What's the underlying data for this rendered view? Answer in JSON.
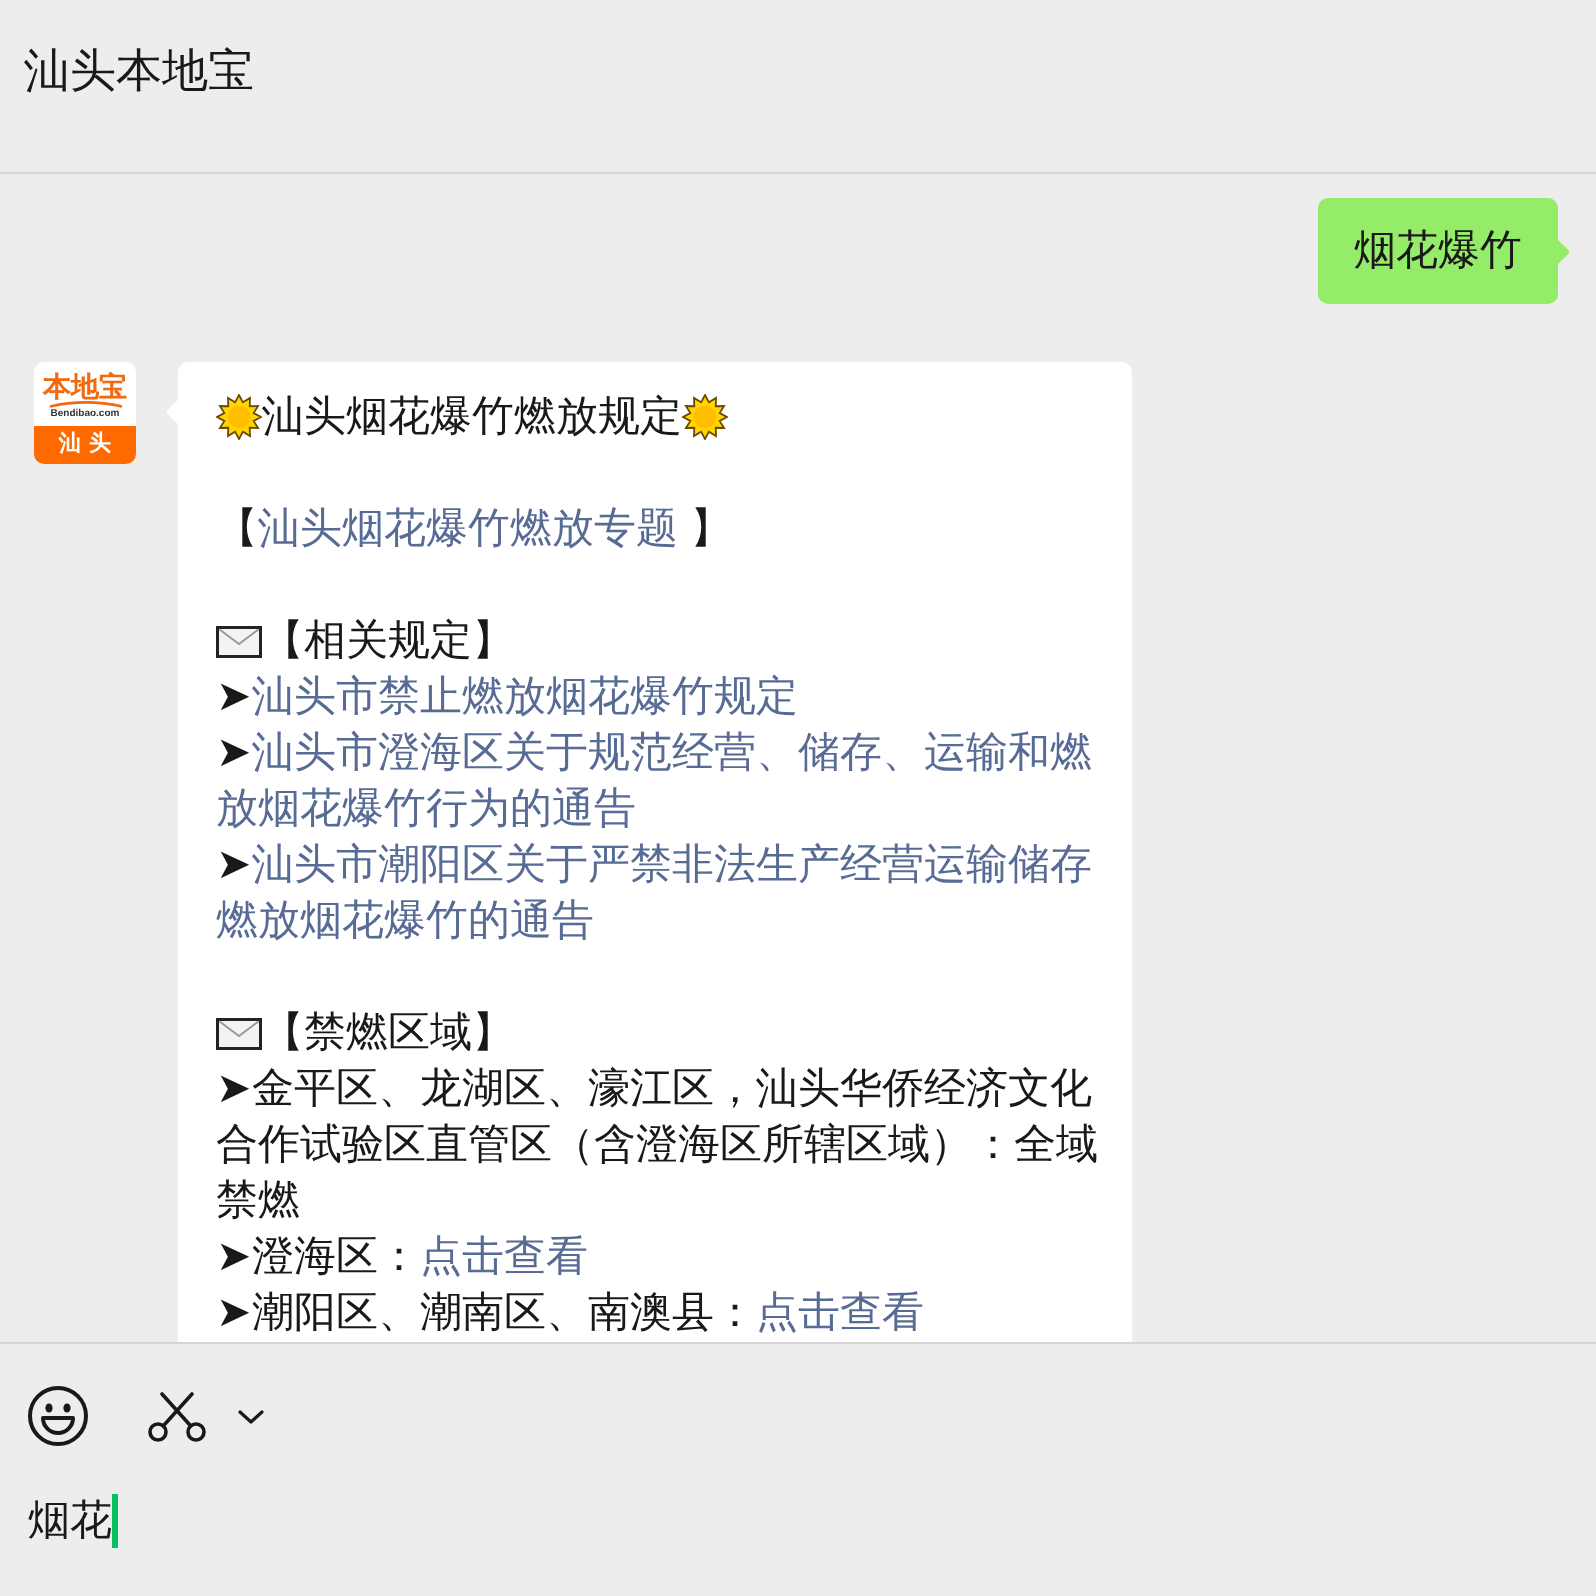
{
  "window": {
    "title": "汕头本地宝"
  },
  "messages": [
    {
      "kind": "sent",
      "text": "烟花爆竹"
    },
    {
      "kind": "received",
      "avatar": {
        "brand": "本地宝",
        "site": "Bendibao.com",
        "city": "汕头"
      },
      "sections": [
        [
          {
            "kind": "sun_title",
            "text": "汕头烟花爆竹燃放规定"
          }
        ],
        [
          {
            "kind": "topic",
            "open": "【",
            "link": "汕头烟花爆竹燃放专题",
            "close": " 】"
          }
        ],
        [
          {
            "kind": "mail_title",
            "text": "【相关规定】"
          },
          {
            "kind": "link_item",
            "bullet": "➤",
            "link": "汕头市禁止燃放烟花爆竹规定"
          },
          {
            "kind": "link_item",
            "bullet": "➤",
            "link": "汕头市澄海区关于规范经营、储存、运输和燃放烟花爆竹行为的通告"
          },
          {
            "kind": "link_item",
            "bullet": "➤",
            "link": "汕头市潮阳区关于严禁非法生产经营运输储存燃放烟花爆竹的通告"
          }
        ],
        [
          {
            "kind": "mail_title",
            "text": "【禁燃区域】"
          },
          {
            "kind": "text_item",
            "text": "➤金平区、龙湖区、濠江区，汕头华侨经济文化合作试验区直管区（含澄海区所辖区域）：全域禁燃"
          },
          {
            "kind": "area_item",
            "text": "➤澄海区：",
            "link": "点击查看"
          },
          {
            "kind": "area_item",
            "text": "➤潮阳区、潮南区、南澳县：",
            "link": "点击查看"
          }
        ]
      ]
    }
  ],
  "composer": {
    "value": "烟花"
  }
}
